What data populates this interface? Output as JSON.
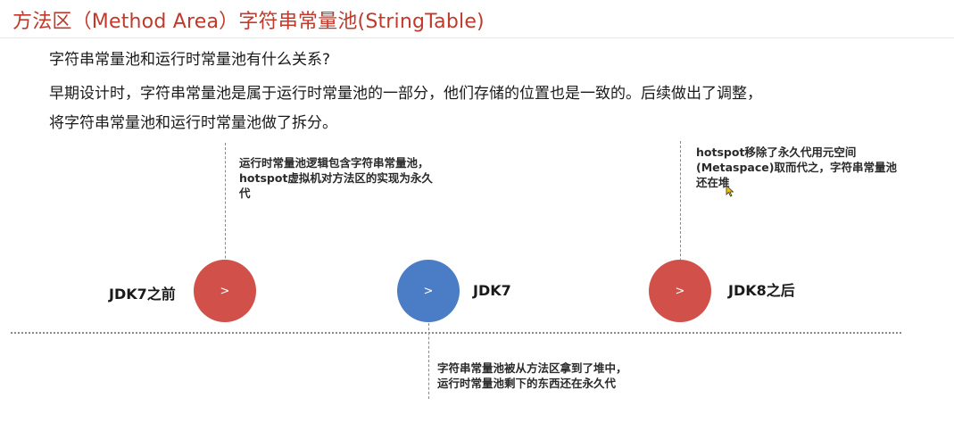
{
  "title": "方法区（Method Area）字符串常量池(StringTable)",
  "colors": {
    "title": "#c0392b",
    "red_node": "#d1504a",
    "blue_node": "#4a7dc6",
    "line": "#8a8a8a"
  },
  "paragraphs": [
    "字符串常量池和运行时常量池有什么关系?",
    "早期设计时，字符串常量池是属于运行时常量池的一部分，他们存储的位置也是一致的。后续做出了调整，",
    "将字符串常量池和运行时常量池做了拆分。"
  ],
  "timeline": {
    "nodes": [
      {
        "label": "JDK7之前",
        "arrow": ">",
        "color": "red"
      },
      {
        "label": "JDK7",
        "arrow": ">",
        "color": "blue"
      },
      {
        "label": "JDK8之后",
        "arrow": ">",
        "color": "red"
      }
    ],
    "notes": {
      "before_jdk7": [
        "运行时常量池逻辑包含字符串常量池，",
        "hotspot虚拟机对方法区的实现为永久",
        "代"
      ],
      "jdk7": [
        "字符串常量池被从方法区拿到了堆中，",
        "运行时常量池剩下的东西还在永久代"
      ],
      "jdk8": [
        "hotspot移除了永久代用元空间",
        "(Metaspace)取而代之，字符串常量池",
        "还在堆"
      ]
    }
  },
  "icons": {
    "cursor": "mouse-cursor-icon"
  }
}
